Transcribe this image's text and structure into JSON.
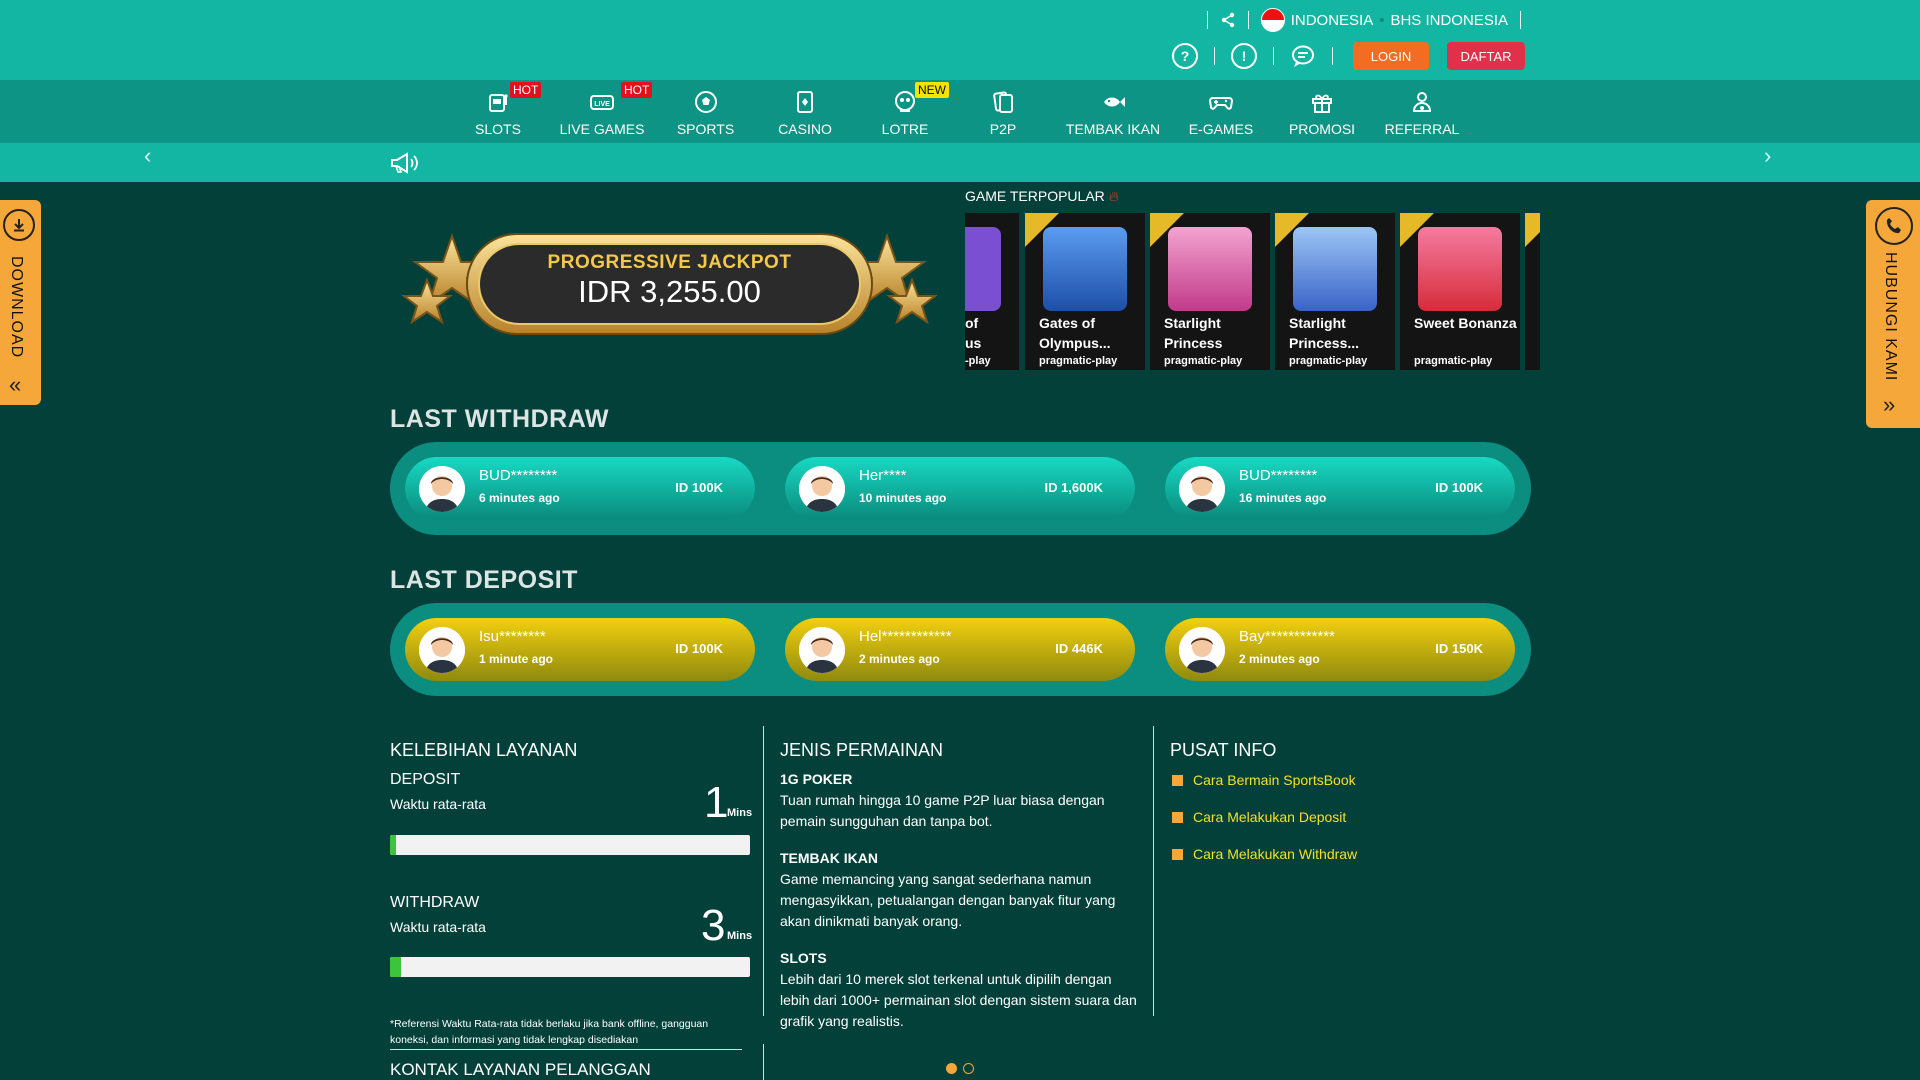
{
  "header": {
    "country": "INDONESIA",
    "language": "BHS INDONESIA",
    "login_label": "LOGIN",
    "daftar_label": "DAFTAR"
  },
  "nav": [
    {
      "label": "SLOTS",
      "badge": "HOT",
      "icon": "slot-machine-icon"
    },
    {
      "label": "LIVE GAMES",
      "badge": "HOT",
      "icon": "live-icon"
    },
    {
      "label": "SPORTS",
      "badge": "",
      "icon": "soccer-ball-icon"
    },
    {
      "label": "CASINO",
      "badge": "",
      "icon": "cards-icon"
    },
    {
      "label": "LOTRE",
      "badge": "NEW",
      "icon": "lottery-icon"
    },
    {
      "label": "P2P",
      "badge": "",
      "icon": "p2p-cards-icon"
    },
    {
      "label": "TEMBAK IKAN",
      "badge": "",
      "icon": "fish-icon"
    },
    {
      "label": "E-GAMES",
      "badge": "",
      "icon": "gamepad-icon"
    },
    {
      "label": "PROMOSI",
      "badge": "",
      "icon": "gift-icon"
    },
    {
      "label": "REFERRAL",
      "badge": "",
      "icon": "referral-icon"
    }
  ],
  "side": {
    "download_label": "DOWNLOAD",
    "contact_label": "HUBUNGI KAMI"
  },
  "jackpot": {
    "title": "PROGRESSIVE JACKPOT",
    "value": "IDR 3,255.00"
  },
  "popular": {
    "title": "GAME TERPOPULAR",
    "games": [
      {
        "name": "of\nus",
        "provider": "-play",
        "hot": false,
        "color": "#7a4fd1"
      },
      {
        "name": "Gates of Olympus...",
        "provider": "pragmatic-play",
        "hot": true,
        "color": "#2a6fd8"
      },
      {
        "name": "Starlight Princess",
        "provider": "pragmatic-play",
        "hot": true,
        "color": "#e45aa6"
      },
      {
        "name": "Starlight Princess...",
        "provider": "pragmatic-play",
        "hot": true,
        "color": "#4b86e6"
      },
      {
        "name": "Sweet Bonanza",
        "provider": "pragmatic-play",
        "hot": true,
        "color": "#e3455a"
      }
    ]
  },
  "withdraw": {
    "title": "LAST WITHDRAW",
    "items": [
      {
        "name": "BUD********",
        "time": "6 minutes ago",
        "amount": "ID 100K"
      },
      {
        "name": "Her****",
        "time": "10 minutes ago",
        "amount": "ID 1,600K"
      },
      {
        "name": "BUD********",
        "time": "16 minutes ago",
        "amount": "ID 100K"
      }
    ]
  },
  "deposit": {
    "title": "LAST DEPOSIT",
    "items": [
      {
        "name": "Isu********",
        "time": "1 minute ago",
        "amount": "ID 100K"
      },
      {
        "name": "Hel************",
        "time": "2 minutes ago",
        "amount": "ID 446K"
      },
      {
        "name": "Bay************",
        "time": "2 minutes ago",
        "amount": "ID 150K"
      }
    ]
  },
  "kelebihan": {
    "title": "KELEBIHAN LAYANAN",
    "deposit_label": "DEPOSIT",
    "deposit_sub": "Waktu rata-rata",
    "deposit_value": "1",
    "deposit_fill": 0.015,
    "withdraw_label": "WITHDRAW",
    "withdraw_sub": "Waktu rata-rata",
    "withdraw_value": "3",
    "withdraw_fill": 0.03,
    "unit": "Mins",
    "footnote": "*Referensi Waktu Rata-rata tidak berlaku jika bank offline, gangguan koneksi, dan informasi yang tidak lengkap disediakan",
    "contact_title": "KONTAK LAYANAN PELANGGAN"
  },
  "jenis": {
    "title": "JENIS PERMAINAN",
    "entries": [
      {
        "h": "1G POKER",
        "t": "Tuan rumah hingga 10 game P2P luar biasa dengan pemain sungguhan dan tanpa bot."
      },
      {
        "h": "TEMBAK IKAN",
        "t": "Game memancing yang sangat sederhana namun mengasyikkan, petualangan dengan banyak fitur yang akan dinikmati banyak orang."
      },
      {
        "h": "SLOTS",
        "t": "Lebih dari 10 merek slot terkenal untuk dipilih dengan lebih dari 1000+ permainan slot dengan sistem suara dan grafik yang realistis."
      }
    ]
  },
  "pusat": {
    "title": "PUSAT INFO",
    "links": [
      "Cara Bermain SportsBook",
      "Cara Melakukan Deposit",
      "Cara Melakukan Withdraw"
    ]
  }
}
